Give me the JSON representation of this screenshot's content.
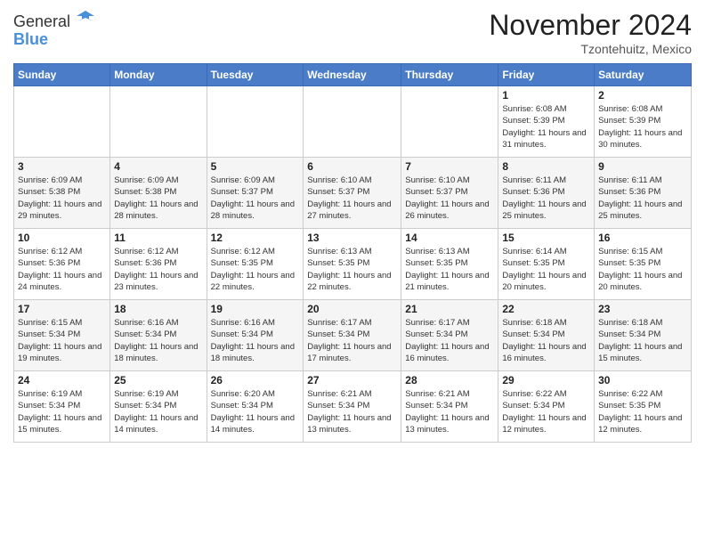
{
  "logo": {
    "general": "General",
    "blue": "Blue"
  },
  "header": {
    "month": "November 2024",
    "location": "Tzontehuitz, Mexico"
  },
  "days_of_week": [
    "Sunday",
    "Monday",
    "Tuesday",
    "Wednesday",
    "Thursday",
    "Friday",
    "Saturday"
  ],
  "weeks": [
    [
      {
        "day": "",
        "info": ""
      },
      {
        "day": "",
        "info": ""
      },
      {
        "day": "",
        "info": ""
      },
      {
        "day": "",
        "info": ""
      },
      {
        "day": "",
        "info": ""
      },
      {
        "day": "1",
        "info": "Sunrise: 6:08 AM\nSunset: 5:39 PM\nDaylight: 11 hours and 31 minutes."
      },
      {
        "day": "2",
        "info": "Sunrise: 6:08 AM\nSunset: 5:39 PM\nDaylight: 11 hours and 30 minutes."
      }
    ],
    [
      {
        "day": "3",
        "info": "Sunrise: 6:09 AM\nSunset: 5:38 PM\nDaylight: 11 hours and 29 minutes."
      },
      {
        "day": "4",
        "info": "Sunrise: 6:09 AM\nSunset: 5:38 PM\nDaylight: 11 hours and 28 minutes."
      },
      {
        "day": "5",
        "info": "Sunrise: 6:09 AM\nSunset: 5:37 PM\nDaylight: 11 hours and 28 minutes."
      },
      {
        "day": "6",
        "info": "Sunrise: 6:10 AM\nSunset: 5:37 PM\nDaylight: 11 hours and 27 minutes."
      },
      {
        "day": "7",
        "info": "Sunrise: 6:10 AM\nSunset: 5:37 PM\nDaylight: 11 hours and 26 minutes."
      },
      {
        "day": "8",
        "info": "Sunrise: 6:11 AM\nSunset: 5:36 PM\nDaylight: 11 hours and 25 minutes."
      },
      {
        "day": "9",
        "info": "Sunrise: 6:11 AM\nSunset: 5:36 PM\nDaylight: 11 hours and 25 minutes."
      }
    ],
    [
      {
        "day": "10",
        "info": "Sunrise: 6:12 AM\nSunset: 5:36 PM\nDaylight: 11 hours and 24 minutes."
      },
      {
        "day": "11",
        "info": "Sunrise: 6:12 AM\nSunset: 5:36 PM\nDaylight: 11 hours and 23 minutes."
      },
      {
        "day": "12",
        "info": "Sunrise: 6:12 AM\nSunset: 5:35 PM\nDaylight: 11 hours and 22 minutes."
      },
      {
        "day": "13",
        "info": "Sunrise: 6:13 AM\nSunset: 5:35 PM\nDaylight: 11 hours and 22 minutes."
      },
      {
        "day": "14",
        "info": "Sunrise: 6:13 AM\nSunset: 5:35 PM\nDaylight: 11 hours and 21 minutes."
      },
      {
        "day": "15",
        "info": "Sunrise: 6:14 AM\nSunset: 5:35 PM\nDaylight: 11 hours and 20 minutes."
      },
      {
        "day": "16",
        "info": "Sunrise: 6:15 AM\nSunset: 5:35 PM\nDaylight: 11 hours and 20 minutes."
      }
    ],
    [
      {
        "day": "17",
        "info": "Sunrise: 6:15 AM\nSunset: 5:34 PM\nDaylight: 11 hours and 19 minutes."
      },
      {
        "day": "18",
        "info": "Sunrise: 6:16 AM\nSunset: 5:34 PM\nDaylight: 11 hours and 18 minutes."
      },
      {
        "day": "19",
        "info": "Sunrise: 6:16 AM\nSunset: 5:34 PM\nDaylight: 11 hours and 18 minutes."
      },
      {
        "day": "20",
        "info": "Sunrise: 6:17 AM\nSunset: 5:34 PM\nDaylight: 11 hours and 17 minutes."
      },
      {
        "day": "21",
        "info": "Sunrise: 6:17 AM\nSunset: 5:34 PM\nDaylight: 11 hours and 16 minutes."
      },
      {
        "day": "22",
        "info": "Sunrise: 6:18 AM\nSunset: 5:34 PM\nDaylight: 11 hours and 16 minutes."
      },
      {
        "day": "23",
        "info": "Sunrise: 6:18 AM\nSunset: 5:34 PM\nDaylight: 11 hours and 15 minutes."
      }
    ],
    [
      {
        "day": "24",
        "info": "Sunrise: 6:19 AM\nSunset: 5:34 PM\nDaylight: 11 hours and 15 minutes."
      },
      {
        "day": "25",
        "info": "Sunrise: 6:19 AM\nSunset: 5:34 PM\nDaylight: 11 hours and 14 minutes."
      },
      {
        "day": "26",
        "info": "Sunrise: 6:20 AM\nSunset: 5:34 PM\nDaylight: 11 hours and 14 minutes."
      },
      {
        "day": "27",
        "info": "Sunrise: 6:21 AM\nSunset: 5:34 PM\nDaylight: 11 hours and 13 minutes."
      },
      {
        "day": "28",
        "info": "Sunrise: 6:21 AM\nSunset: 5:34 PM\nDaylight: 11 hours and 13 minutes."
      },
      {
        "day": "29",
        "info": "Sunrise: 6:22 AM\nSunset: 5:34 PM\nDaylight: 11 hours and 12 minutes."
      },
      {
        "day": "30",
        "info": "Sunrise: 6:22 AM\nSunset: 5:35 PM\nDaylight: 11 hours and 12 minutes."
      }
    ]
  ]
}
